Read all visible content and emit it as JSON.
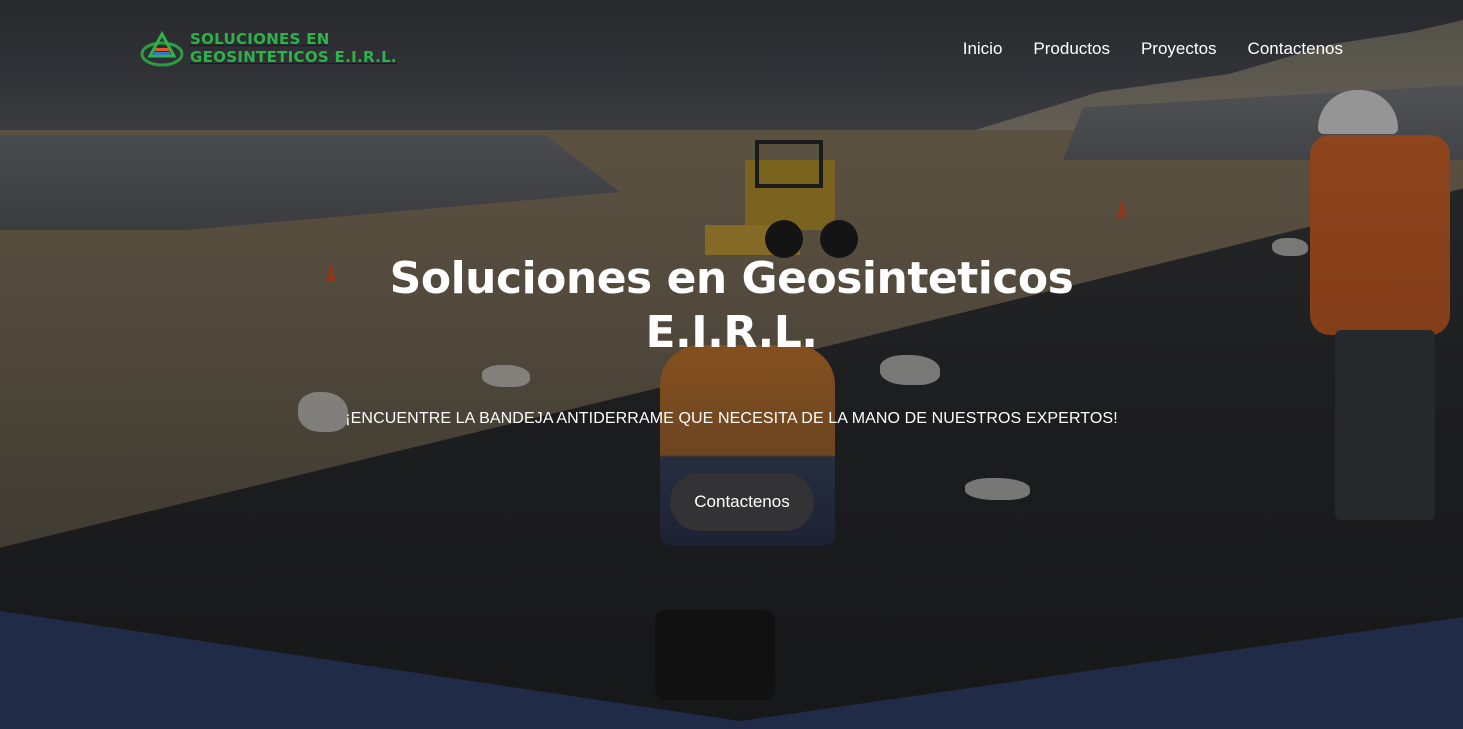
{
  "brand": {
    "line1": "SOLUCIONES EN",
    "line2": "GEOSINTETICOS E.I.R.L.",
    "icon": "geo-logo-icon",
    "color": "#2db34a"
  },
  "nav": {
    "items": [
      "Inicio",
      "Productos",
      "Proyectos",
      "Contactenos"
    ]
  },
  "hero": {
    "title": "Soluciones en Geosinteticos E.I.R.L.",
    "subtitle": "¡ENCUENTRE LA BANDEJA ANTIDERRAME QUE NECESITA DE LA MANO DE NUESTROS EXPERTOS!",
    "cta_label": "Contactenos"
  },
  "colors": {
    "divider": "#1f2b47",
    "cta_bg": "#333336"
  }
}
